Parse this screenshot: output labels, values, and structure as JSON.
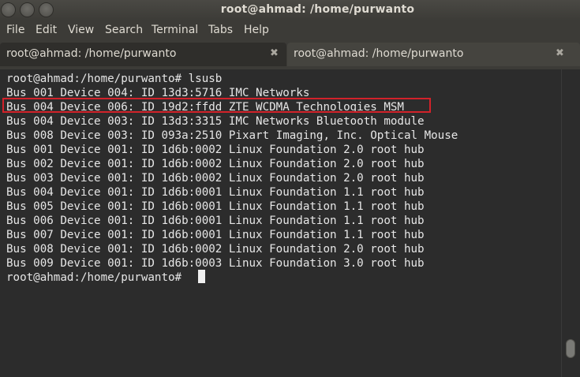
{
  "window": {
    "title": "root@ahmad: /home/purwanto"
  },
  "menu": {
    "items": [
      "File",
      "Edit",
      "View",
      "Search",
      "Terminal",
      "Tabs",
      "Help"
    ]
  },
  "tabs": [
    {
      "label": "root@ahmad: /home/purwanto",
      "close_glyph": "✖"
    },
    {
      "label": "root@ahmad: /home/purwanto",
      "close_glyph": "✖"
    }
  ],
  "terminal": {
    "lines": [
      "root@ahmad:/home/purwanto# lsusb",
      "Bus 001 Device 004: ID 13d3:5716 IMC Networks",
      "Bus 004 Device 006: ID 19d2:ffdd ZTE WCDMA Technologies MSM",
      "Bus 004 Device 003: ID 13d3:3315 IMC Networks Bluetooth module",
      "Bus 008 Device 003: ID 093a:2510 Pixart Imaging, Inc. Optical Mouse",
      "Bus 001 Device 001: ID 1d6b:0002 Linux Foundation 2.0 root hub",
      "Bus 002 Device 001: ID 1d6b:0002 Linux Foundation 2.0 root hub",
      "Bus 003 Device 001: ID 1d6b:0002 Linux Foundation 2.0 root hub",
      "Bus 004 Device 001: ID 1d6b:0001 Linux Foundation 1.1 root hub",
      "Bus 005 Device 001: ID 1d6b:0001 Linux Foundation 1.1 root hub",
      "Bus 006 Device 001: ID 1d6b:0001 Linux Foundation 1.1 root hub",
      "Bus 007 Device 001: ID 1d6b:0001 Linux Foundation 1.1 root hub",
      "Bus 008 Device 001: ID 1d6b:0002 Linux Foundation 2.0 root hub",
      "Bus 009 Device 001: ID 1d6b:0003 Linux Foundation 3.0 root hub",
      "root@ahmad:/home/purwanto# "
    ],
    "highlight_color": "#d2222a"
  },
  "icons": {
    "window_close": "close-icon",
    "window_minimize": "minimize-icon",
    "window_maximize": "maximize-icon"
  }
}
